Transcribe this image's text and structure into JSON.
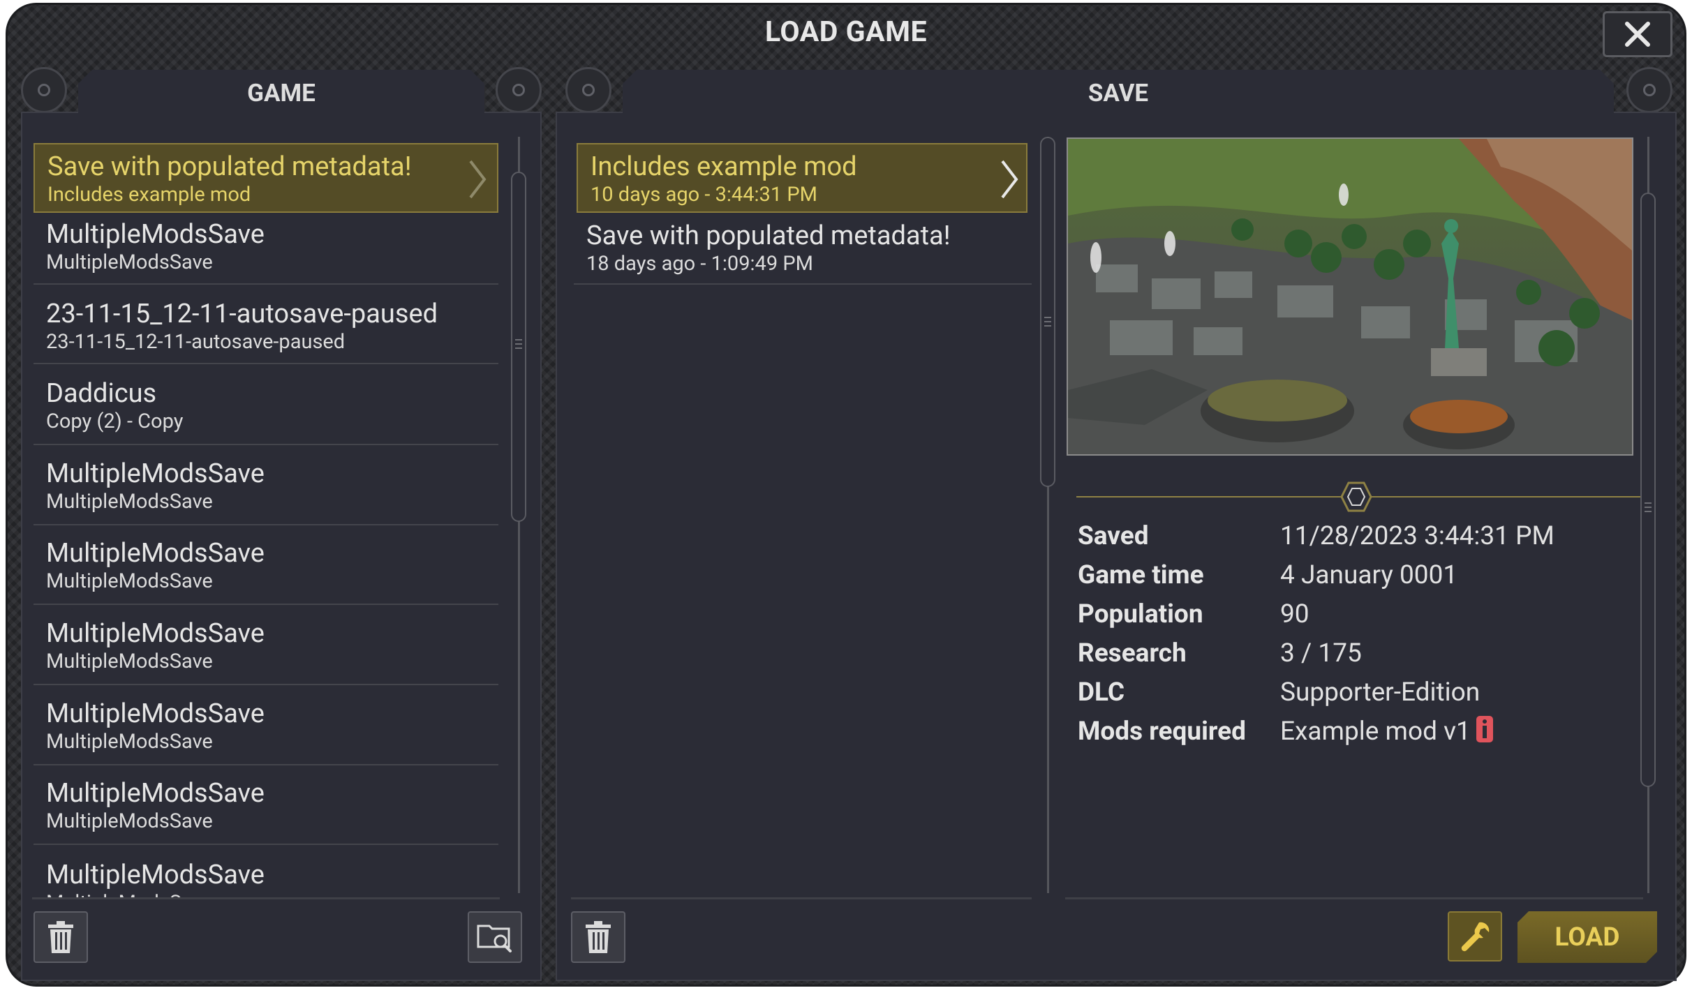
{
  "window": {
    "title": "LOAD GAME"
  },
  "game_panel": {
    "tab_label": "GAME",
    "items": [
      {
        "title": "Save with populated metadata!",
        "subtitle": "Includes example mod",
        "selected": true
      },
      {
        "title": "MultipleModsSave",
        "subtitle": "MultipleModsSave"
      },
      {
        "title": "23-11-15_12-11-autosave-paused",
        "subtitle": "23-11-15_12-11-autosave-paused"
      },
      {
        "title": "Daddicus",
        "subtitle": "Copy (2) - Copy"
      },
      {
        "title": "MultipleModsSave",
        "subtitle": "MultipleModsSave"
      },
      {
        "title": "MultipleModsSave",
        "subtitle": "MultipleModsSave"
      },
      {
        "title": "MultipleModsSave",
        "subtitle": "MultipleModsSave"
      },
      {
        "title": "MultipleModsSave",
        "subtitle": "MultipleModsSave"
      },
      {
        "title": "MultipleModsSave",
        "subtitle": "MultipleModsSave"
      },
      {
        "title": "MultipleModsSave",
        "subtitle": "MultipleModsSave"
      }
    ]
  },
  "save_panel": {
    "tab_label": "SAVE",
    "items": [
      {
        "title": "Includes example mod",
        "subtitle": "10 days ago - 3:44:31 PM",
        "selected": true
      },
      {
        "title": "Save with populated metadata!",
        "subtitle": "18 days ago - 1:09:49 PM"
      }
    ],
    "details": [
      {
        "key": "Saved",
        "value": "11/28/2023 3:44:31 PM"
      },
      {
        "key": "Game time",
        "value": "4 January 0001"
      },
      {
        "key": "Population",
        "value": "90"
      },
      {
        "key": "Research",
        "value": "3 / 175"
      },
      {
        "key": "DLC",
        "value": "Supporter-Edition"
      },
      {
        "key": "Mods required",
        "value": "Example mod v1"
      }
    ],
    "load_label": "LOAD"
  },
  "icons": {
    "close": "close-icon",
    "delete": "trash-icon",
    "browse": "folder-search-icon",
    "settings": "wrench-icon",
    "info": "info-icon"
  },
  "colors": {
    "accent": "#e6d46a",
    "selected_bg": "#544c26",
    "warning": "#e0545c",
    "panel_bg": "#2b2c36"
  }
}
